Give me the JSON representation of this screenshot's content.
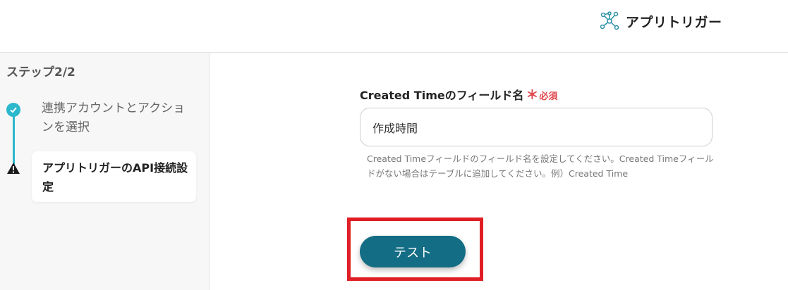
{
  "header": {
    "brand_icon": "network-nodes-icon",
    "title": "アプリトリガー"
  },
  "sidebar": {
    "heading": "ステップ2/2",
    "steps": [
      {
        "label": "連携アカウントとアクションを選択",
        "status": "completed",
        "icon": "check-icon"
      },
      {
        "label": "アプリトリガーのAPI接続設定",
        "status": "current-warning",
        "icon": "warning-icon"
      }
    ]
  },
  "form": {
    "field_label": "Created Timeのフィールド名",
    "required_mark": "＊",
    "required_text": "必須",
    "value": "作成時間",
    "help": "Created Timeフィールドのフィールド名を設定してください。Created Timeフィールドがない場合はテーブルに追加してください。例）Created Time"
  },
  "actions": {
    "test_label": "テスト"
  },
  "colors": {
    "accent": "#2bb8cc",
    "button": "#136d84",
    "required": "#e0474c",
    "highlight": "#e01e25"
  }
}
